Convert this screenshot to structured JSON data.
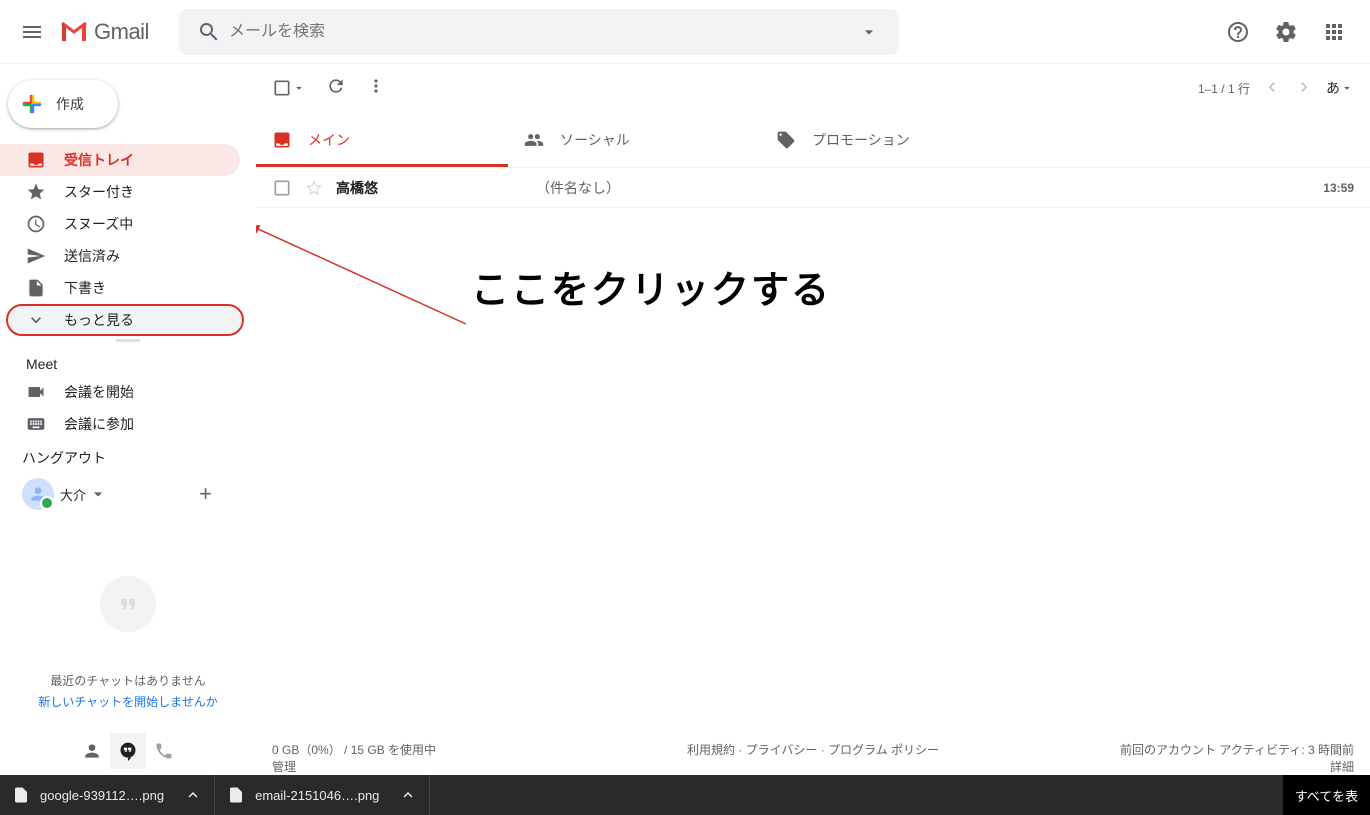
{
  "header": {
    "app_name": "Gmail",
    "search_placeholder": "メールを検索"
  },
  "compose_label": "作成",
  "nav": {
    "inbox": "受信トレイ",
    "starred": "スター付き",
    "snoozed": "スヌーズ中",
    "sent": "送信済み",
    "drafts": "下書き",
    "more": "もっと見る"
  },
  "meet": {
    "title": "Meet",
    "start": "会議を開始",
    "join": "会議に参加"
  },
  "hangouts": {
    "title": "ハングアウト",
    "user": "大介",
    "empty_line1": "最近のチャットはありません",
    "empty_line2": "新しいチャットを開始しませんか"
  },
  "toolbar": {
    "pagination": "1–1 / 1 行",
    "input_lang": "あ"
  },
  "tabs": {
    "primary": "メイン",
    "social": "ソーシャル",
    "promotions": "プロモーション"
  },
  "emails": [
    {
      "sender": "高橋悠",
      "subject": "（件名なし）",
      "time": "13:59"
    }
  ],
  "annotation_text": "ここをクリックする",
  "footer": {
    "storage_line1": "0 GB（0%） / 15 GB を使用中",
    "storage_line2": "管理",
    "policies": "利用規約 · プライバシー · プログラム ポリシー",
    "activity_line1": "前回のアカウント アクティビティ: 3 時間前",
    "activity_line2": "詳細"
  },
  "downloads": {
    "file1": "google-939112….png",
    "file2": "email-2151046….png",
    "show_all": "すべてを表"
  }
}
